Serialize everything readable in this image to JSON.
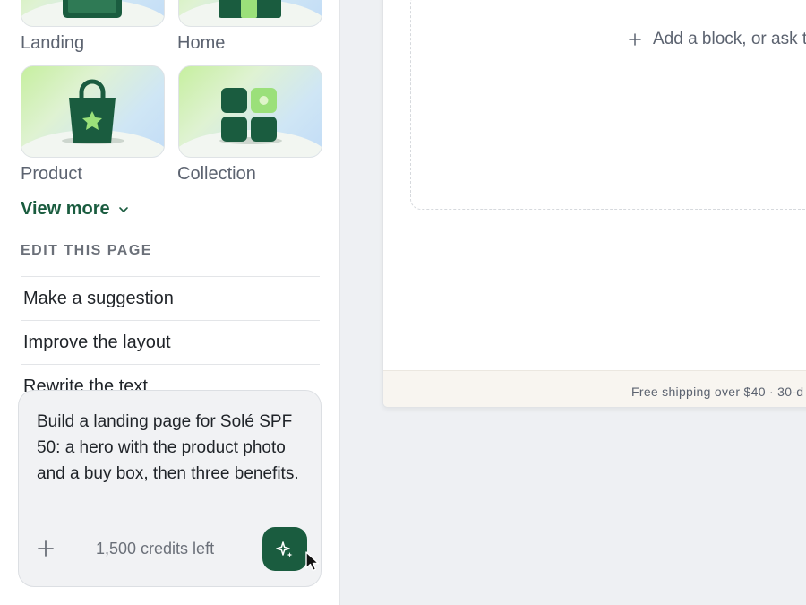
{
  "templates": [
    {
      "label": "Landing",
      "icon": "landing-page-icon"
    },
    {
      "label": "Home",
      "icon": "home-page-icon"
    },
    {
      "label": "Product",
      "icon": "shopping-bag-icon"
    },
    {
      "label": "Collection",
      "icon": "collection-grid-icon"
    }
  ],
  "view_more_label": "View more",
  "section_title": "EDIT THIS PAGE",
  "suggestions": [
    "Make a suggestion",
    "Improve the layout",
    "Rewrite the text"
  ],
  "prompt": {
    "text": "Build a landing page for Solé SPF 50: a hero with the product photo and a buy box, then three benefits.",
    "credits": "1,500 credits left"
  },
  "canvas": {
    "add_block_label": "Add a block, or ask t",
    "footer_text": "Free shipping over $40 · 30-d"
  },
  "colors": {
    "brand_green": "#1a5c3f",
    "accent_light_green": "#9be07a",
    "footer_bg": "#f8f5f0"
  }
}
